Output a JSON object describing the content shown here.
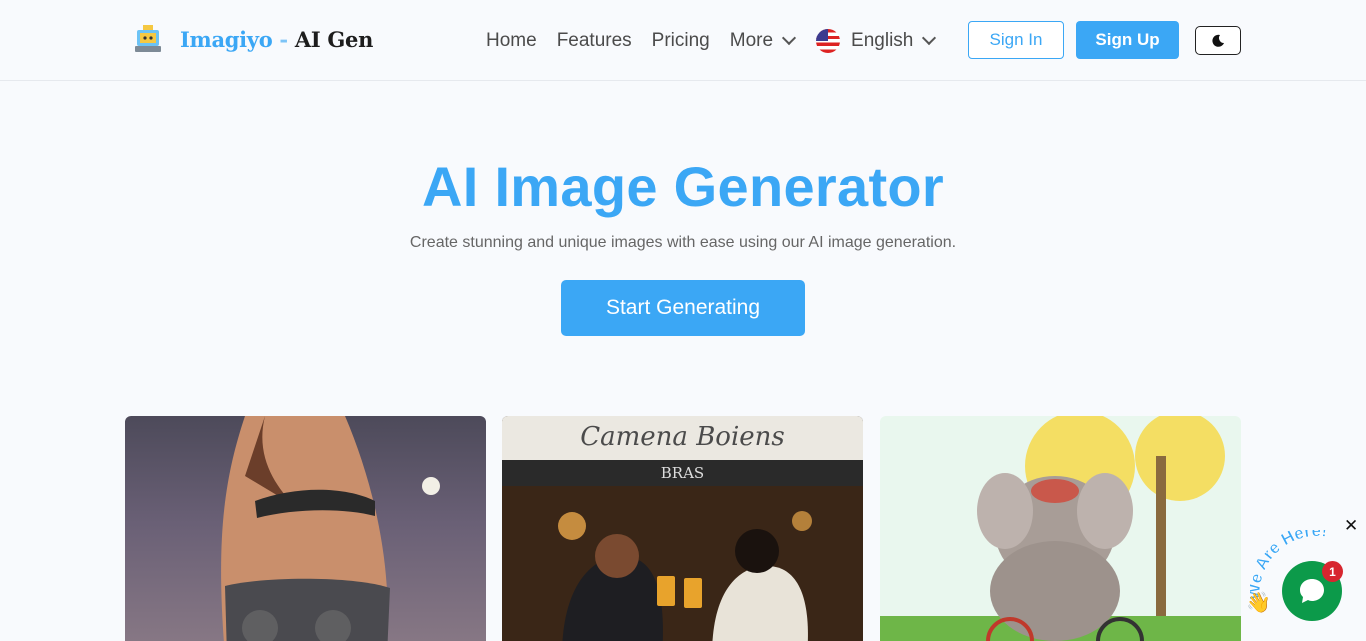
{
  "header": {
    "brand_name": "Imagiyo",
    "brand_dash": " - ",
    "brand_suffix": "AI Gen",
    "nav": [
      {
        "label": "Home"
      },
      {
        "label": "Features"
      },
      {
        "label": "Pricing"
      },
      {
        "label": "More"
      }
    ],
    "language": "English",
    "sign_in": "Sign In",
    "sign_up": "Sign Up",
    "theme_icon": "moon-icon"
  },
  "hero": {
    "title": "AI Image Generator",
    "subtitle": "Create stunning and unique images with ease using our AI image generation.",
    "cta": "Start Generating"
  },
  "gallery": {
    "card2_sign_top": "Camena Boiens",
    "card2_sign_bottom": "BRAS"
  },
  "chat_widget": {
    "label": "We Are Here!",
    "badge_count": "1",
    "close": "✕"
  },
  "colors": {
    "accent": "#3ba7f5",
    "chat_green": "#0c9a4a",
    "badge_red": "#d7262f"
  }
}
